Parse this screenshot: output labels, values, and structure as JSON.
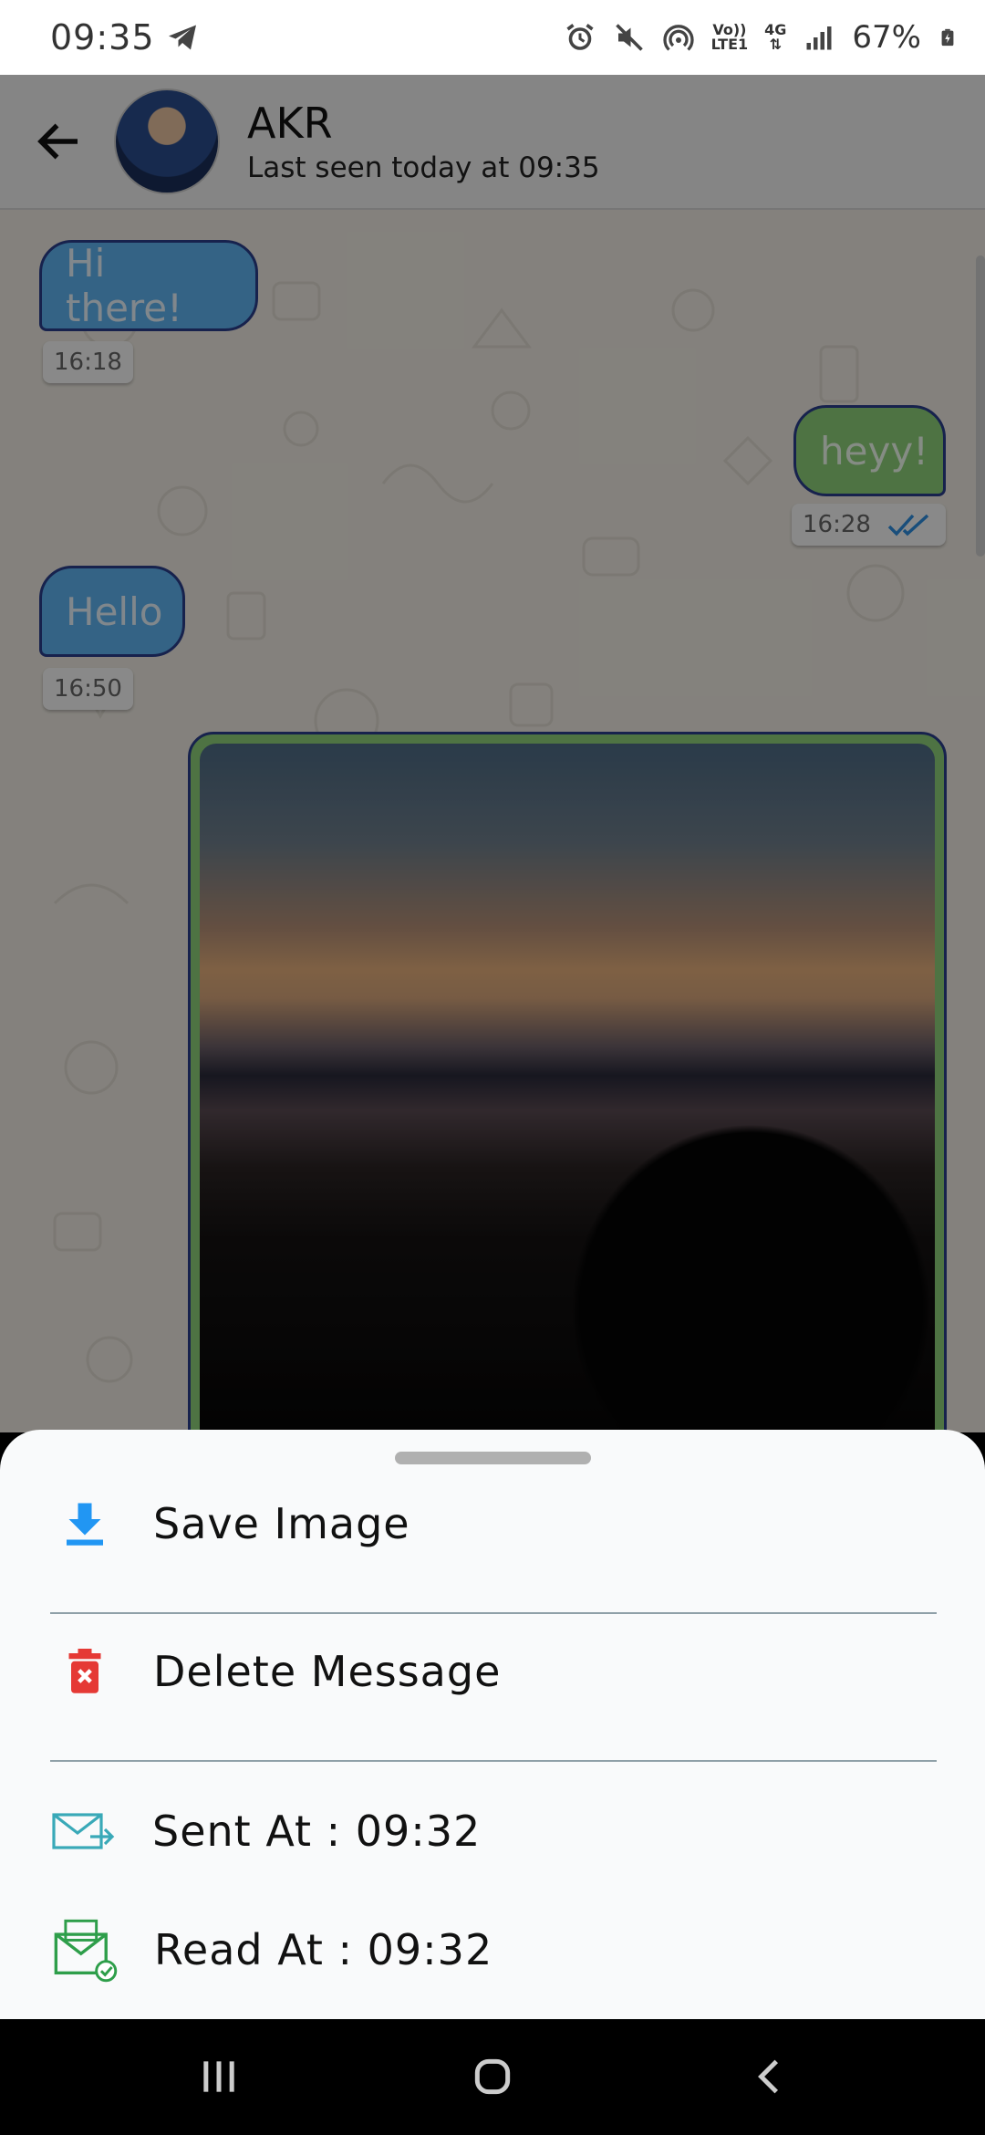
{
  "status_bar": {
    "time": "09:35",
    "volte_label_top": "Vo))",
    "volte_label_bottom": "LTE1",
    "network_label": "4G",
    "battery": "67%"
  },
  "header": {
    "contact_name": "AKR",
    "last_seen": "Last seen today at 09:35"
  },
  "messages": [
    {
      "text": "Hi there!",
      "time": "16:18",
      "direction": "incoming"
    },
    {
      "text": "heyy!",
      "time": "16:28",
      "direction": "outgoing",
      "read": true
    },
    {
      "text": "Hello",
      "time": "16:50",
      "direction": "incoming"
    }
  ],
  "sheet": {
    "save_image": "Save Image",
    "delete_message": "Delete Message",
    "sent_at": "Sent At : 09:32",
    "read_at": "Read At : 09:32"
  },
  "colors": {
    "incoming_bubble": "#5fb4f2",
    "outgoing_bubble": "#8ed27a",
    "bubble_border": "#2a3f8c",
    "download_icon": "#2196f3",
    "delete_icon": "#e53935"
  }
}
